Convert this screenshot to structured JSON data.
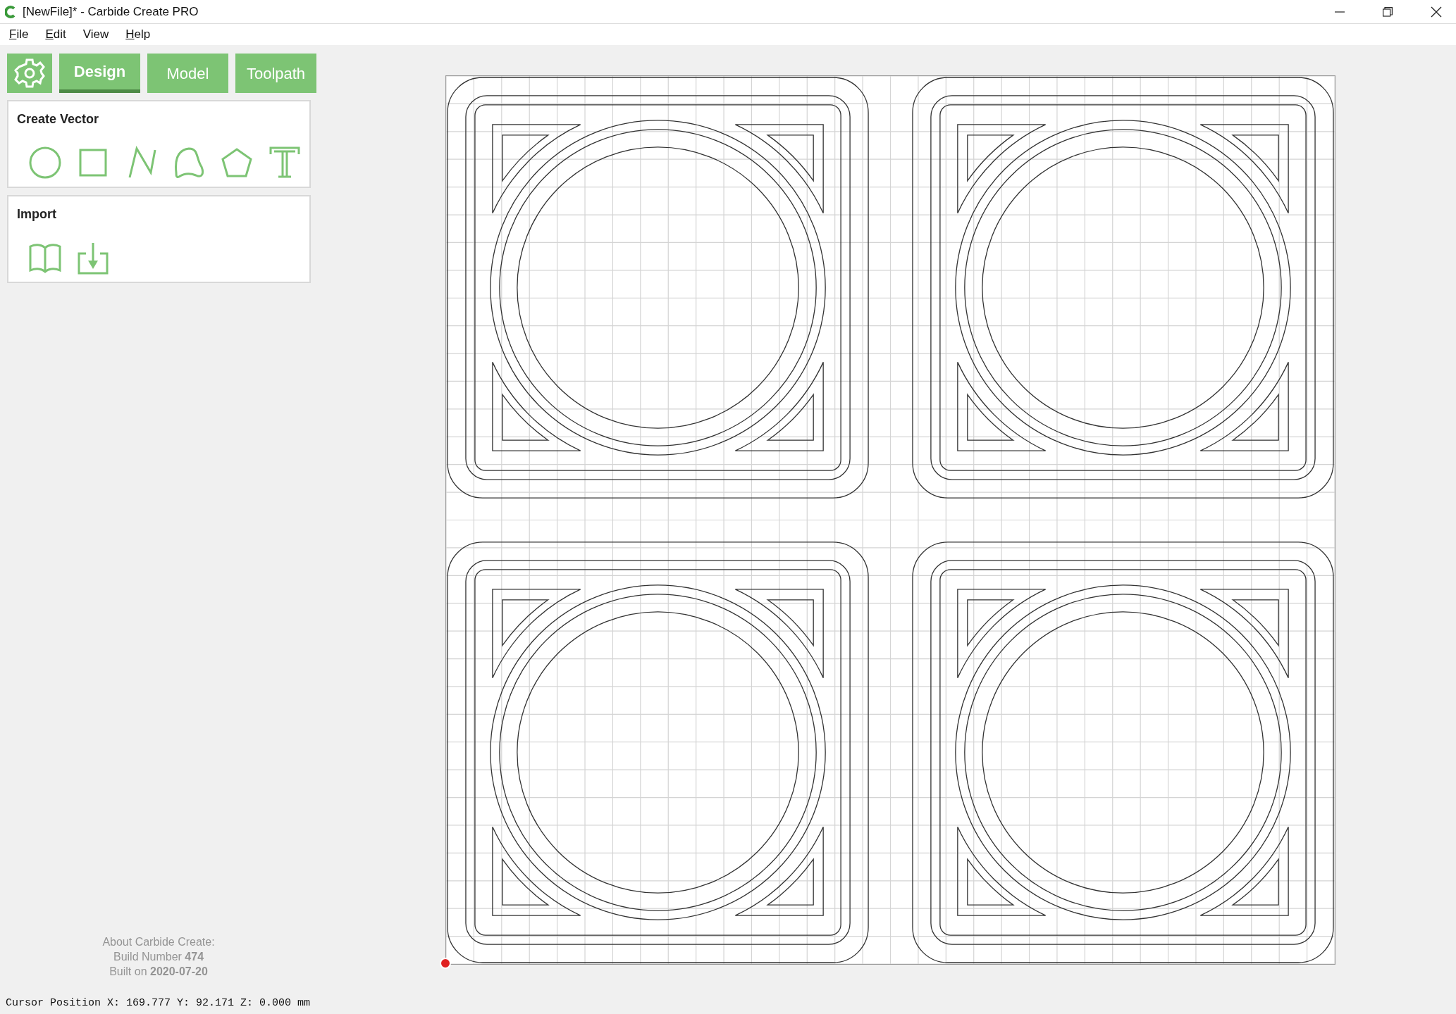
{
  "window": {
    "title": "[NewFile]* - Carbide Create PRO"
  },
  "menu": [
    {
      "label": "File",
      "mnemonic": true
    },
    {
      "label": "Edit",
      "mnemonic": true
    },
    {
      "label": "View",
      "mnemonic": false
    },
    {
      "label": "Help",
      "mnemonic": true
    }
  ],
  "tabs": [
    {
      "kind": "settings",
      "selected": false
    },
    {
      "kind": "text",
      "label": "Design",
      "selected": true
    },
    {
      "kind": "text",
      "label": "Model",
      "selected": false
    },
    {
      "kind": "text",
      "label": "Toolpath",
      "selected": false
    }
  ],
  "panels": [
    {
      "title": "Create Vector",
      "kind": "create"
    },
    {
      "title": "Import",
      "kind": "import"
    }
  ],
  "about": [
    "About Carbide Create:",
    "Build Number **474**",
    "Built on **2020-07-20**"
  ],
  "status_bar": "Cursor Position X: 169.777 Y: 92.171 Z: 0.000 mm"
}
